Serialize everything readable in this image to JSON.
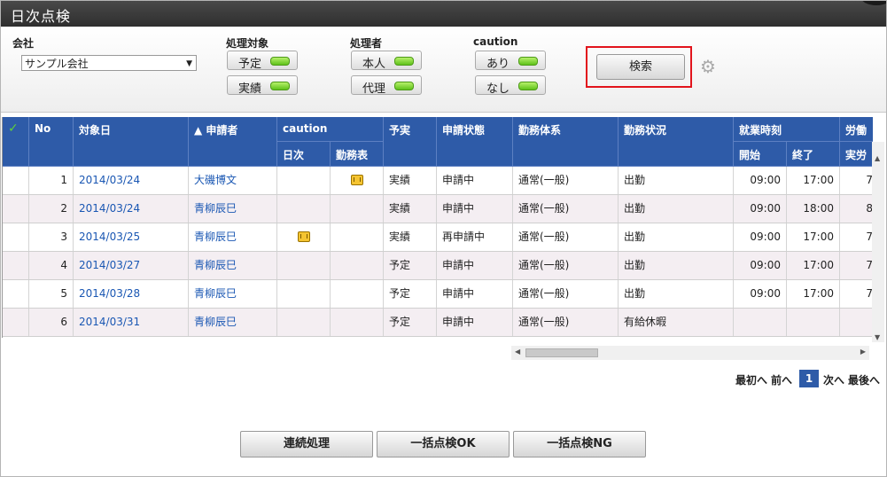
{
  "window": {
    "title": "日次点検"
  },
  "filter": {
    "company_label": "会社",
    "company_value": "サンプル会社",
    "target_label": "処理対象",
    "target_buttons": [
      "予定",
      "実績"
    ],
    "processor_label": "処理者",
    "processor_buttons": [
      "本人",
      "代理"
    ],
    "caution_label": "caution",
    "caution_buttons": [
      "あり",
      "なし"
    ],
    "search_label": "検索"
  },
  "grid": {
    "headers": {
      "check": "✓",
      "no": "No",
      "date": "対象日",
      "applicant": "▲ 申請者",
      "caution": "caution",
      "daily": "日次",
      "worksheet": "勤務表",
      "plan_actual": "予実",
      "status": "申請状態",
      "work_system": "勤務体系",
      "work_state": "勤務状況",
      "work_time": "就業時刻",
      "start": "開始",
      "end": "終了",
      "labor": "労働",
      "actual": "実労"
    },
    "rows": [
      {
        "no": "1",
        "date": "2014/03/24",
        "applicant": "大磯博文",
        "daily_icon": false,
        "sheet_icon": true,
        "plan_actual": "実績",
        "status": "申請中",
        "system": "通常(一般)",
        "state": "出勤",
        "start": "09:00",
        "end": "17:00",
        "actual": "7"
      },
      {
        "no": "2",
        "date": "2014/03/24",
        "applicant": "青柳辰巳",
        "daily_icon": false,
        "sheet_icon": false,
        "plan_actual": "実績",
        "status": "申請中",
        "system": "通常(一般)",
        "state": "出勤",
        "start": "09:00",
        "end": "18:00",
        "actual": "8"
      },
      {
        "no": "3",
        "date": "2014/03/25",
        "applicant": "青柳辰巳",
        "daily_icon": true,
        "sheet_icon": false,
        "plan_actual": "実績",
        "status": "再申請中",
        "system": "通常(一般)",
        "state": "出勤",
        "start": "09:00",
        "end": "17:00",
        "actual": "7"
      },
      {
        "no": "4",
        "date": "2014/03/27",
        "applicant": "青柳辰巳",
        "daily_icon": false,
        "sheet_icon": false,
        "plan_actual": "予定",
        "status": "申請中",
        "system": "通常(一般)",
        "state": "出勤",
        "start": "09:00",
        "end": "17:00",
        "actual": "7"
      },
      {
        "no": "5",
        "date": "2014/03/28",
        "applicant": "青柳辰巳",
        "daily_icon": false,
        "sheet_icon": false,
        "plan_actual": "予定",
        "status": "申請中",
        "system": "通常(一般)",
        "state": "出勤",
        "start": "09:00",
        "end": "17:00",
        "actual": "7"
      },
      {
        "no": "6",
        "date": "2014/03/31",
        "applicant": "青柳辰巳",
        "daily_icon": false,
        "sheet_icon": false,
        "plan_actual": "予定",
        "status": "申請中",
        "system": "通常(一般)",
        "state": "有給休暇",
        "start": "",
        "end": "",
        "actual": ""
      }
    ]
  },
  "pager": {
    "first": "最初へ",
    "prev": "前へ",
    "current": "1",
    "next": "次へ",
    "last": "最後へ"
  },
  "actions": {
    "batch": "連続処理",
    "bulk_ok": "一括点検OK",
    "bulk_ng": "一括点検NG"
  },
  "icons": {
    "caution_icon": "calendar-icon",
    "settings_icon": "gear-icon",
    "check_icon": "checkmark-icon"
  },
  "colors": {
    "header_blue": "#2e5ba8",
    "highlight_red": "#e2141c",
    "led_green": "#5fc21a",
    "link_blue": "#1a57b3"
  }
}
